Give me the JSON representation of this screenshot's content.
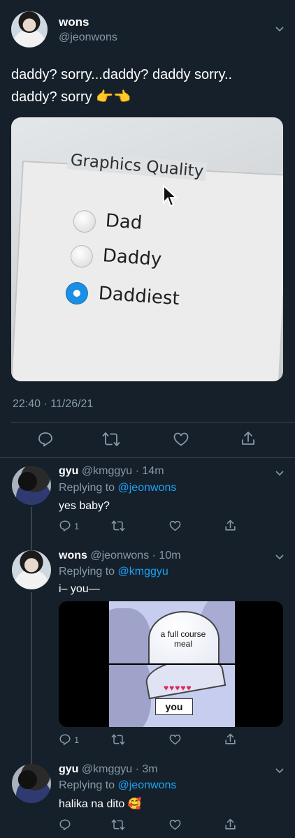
{
  "main_tweet": {
    "name": "wons",
    "handle": "@jeonwons",
    "text_line1": "daddy? sorry...daddy? daddy sorry..",
    "text_line2": "daddy? sorry 👉👈",
    "image": {
      "heading": "Graphics Quality",
      "options": [
        "Dad",
        "Daddy",
        "Daddiest"
      ],
      "selected": "Daddiest"
    },
    "timestamp": "22:40 · 11/26/21"
  },
  "replies": [
    {
      "name": "gyu",
      "handle": "@kmggyu",
      "time": "· 14m",
      "replying_prefix": "Replying to ",
      "replying_to": "@jeonwons",
      "text": "yes baby?",
      "reply_count": "1"
    },
    {
      "name": "wons",
      "handle": "@jeonwons",
      "time": "· 10m",
      "replying_prefix": "Replying to ",
      "replying_to": "@kmggyu",
      "text": "i– you—",
      "meme": {
        "top_label": "a full course meal",
        "bottom_label": "you"
      },
      "reply_count": "1"
    },
    {
      "name": "gyu",
      "handle": "@kmggyu",
      "time": "· 3m",
      "replying_prefix": "Replying to ",
      "replying_to": "@jeonwons",
      "text": "halika na dito 🥰"
    }
  ],
  "colors": {
    "background": "#15202b",
    "muted": "#8899a6",
    "link": "#1da1f2",
    "divider": "#38444d"
  },
  "icons": [
    "reply-icon",
    "retweet-icon",
    "like-icon",
    "share-icon",
    "chevron-down-icon"
  ]
}
